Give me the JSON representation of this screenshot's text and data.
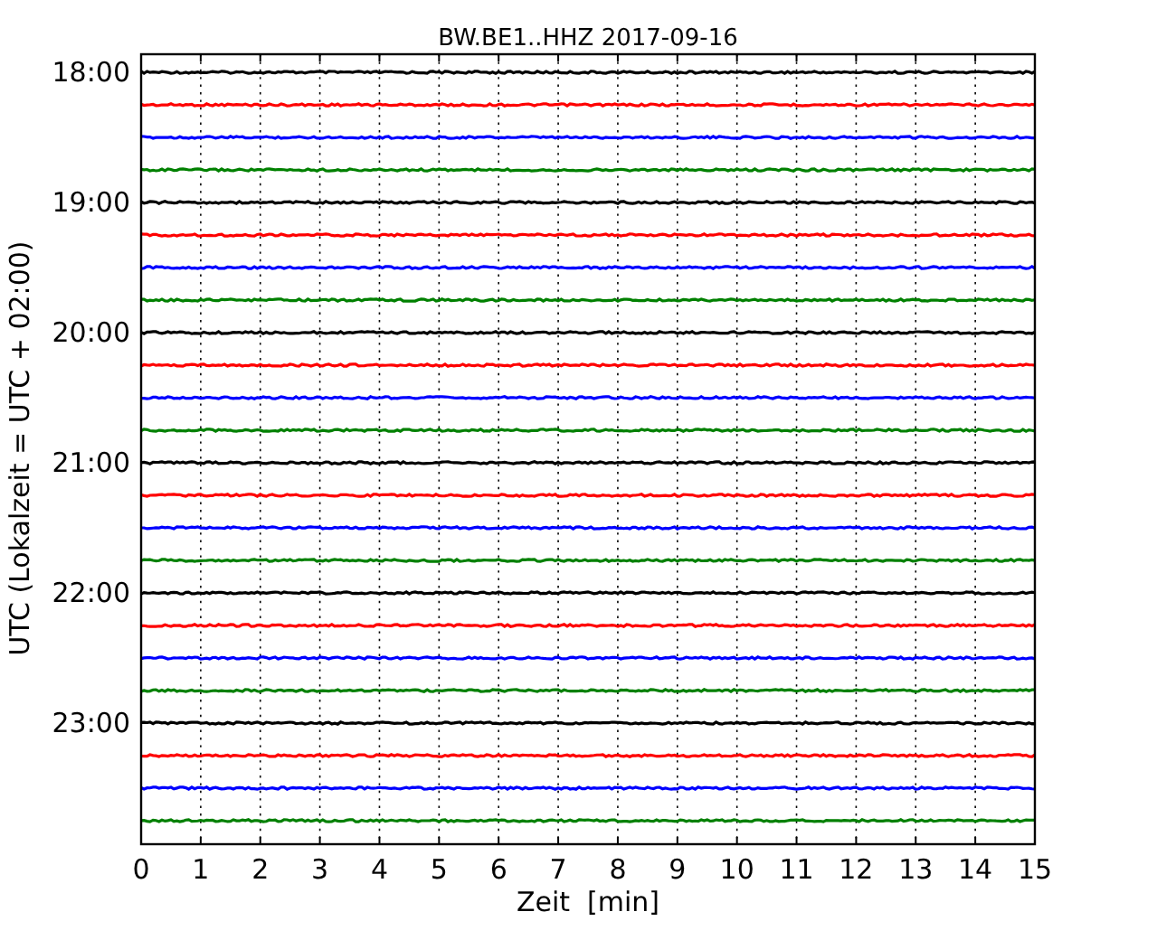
{
  "title": "BW.BE1..HHZ 2017-09-16",
  "xlabel": "Zeit  [min]",
  "ylabel": "UTC (Lokalzeit = UTC + 02:00)",
  "xticks": [
    "0",
    "1",
    "2",
    "3",
    "4",
    "5",
    "6",
    "7",
    "8",
    "9",
    "10",
    "11",
    "12",
    "13",
    "14",
    "15"
  ],
  "traces": [
    {
      "time_label": "18:00",
      "color": "#000000"
    },
    {
      "color": "#ff0000"
    },
    {
      "color": "#0000ff"
    },
    {
      "color": "#008000"
    },
    {
      "time_label": "19:00",
      "color": "#000000"
    },
    {
      "color": "#ff0000"
    },
    {
      "color": "#0000ff"
    },
    {
      "color": "#008000"
    },
    {
      "time_label": "20:00",
      "color": "#000000"
    },
    {
      "color": "#ff0000"
    },
    {
      "color": "#0000ff"
    },
    {
      "color": "#008000"
    },
    {
      "time_label": "21:00",
      "color": "#000000"
    },
    {
      "color": "#ff0000"
    },
    {
      "color": "#0000ff"
    },
    {
      "color": "#008000"
    },
    {
      "time_label": "22:00",
      "color": "#000000"
    },
    {
      "color": "#ff0000"
    },
    {
      "color": "#0000ff"
    },
    {
      "color": "#008000"
    },
    {
      "time_label": "23:00",
      "color": "#000000"
    },
    {
      "color": "#ff0000"
    },
    {
      "color": "#0000ff"
    },
    {
      "color": "#008000"
    }
  ]
}
